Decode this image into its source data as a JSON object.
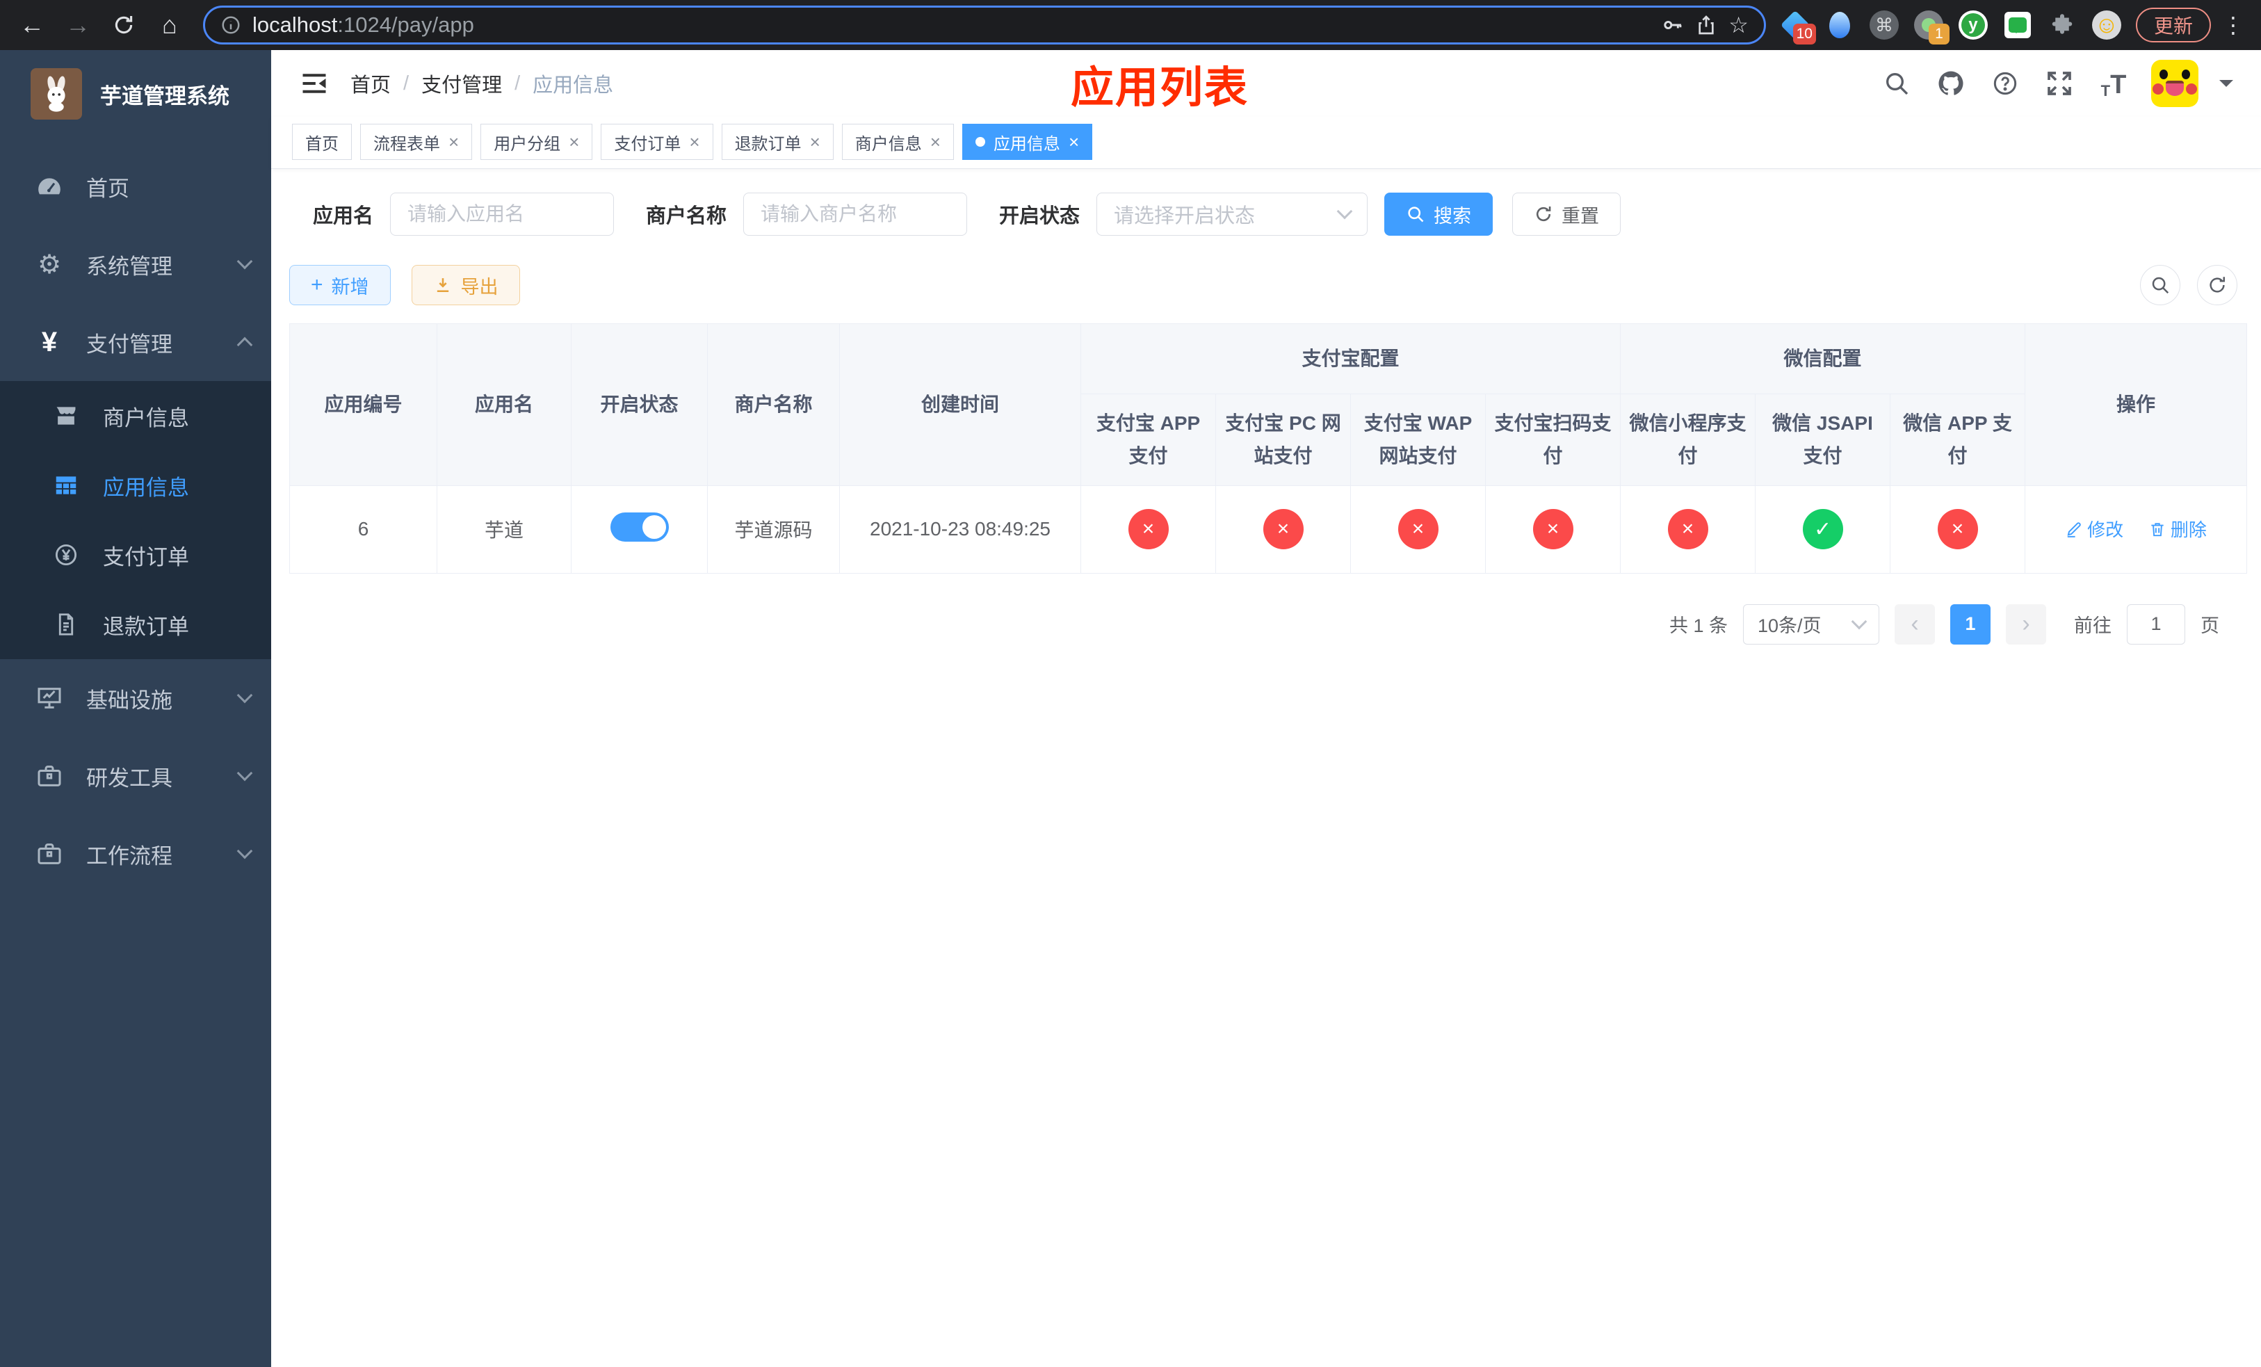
{
  "colors": {
    "accent": "#409eff",
    "success": "#15ce67",
    "danger": "#fb4a4a",
    "warning": "#e6a23c",
    "sidebar_bg": "#304156",
    "submenu_bg": "#1f2d3d",
    "annotation_red": "#ff2d00"
  },
  "browser": {
    "url": {
      "host": "localhost",
      "rest": ":1024/pay/app"
    },
    "update_label": "更新",
    "extensions": {
      "diamond_badge": "10",
      "camera_badge": "1",
      "y_letter": "y"
    }
  },
  "sidebar": {
    "title": "芋道管理系统",
    "menu": [
      {
        "label": "首页"
      },
      {
        "label": "系统管理"
      },
      {
        "label": "支付管理"
      },
      {
        "label": "基础设施"
      },
      {
        "label": "研发工具"
      },
      {
        "label": "工作流程"
      }
    ],
    "submenu_pay": [
      {
        "label": "商户信息"
      },
      {
        "label": "应用信息"
      },
      {
        "label": "支付订单"
      },
      {
        "label": "退款订单"
      }
    ]
  },
  "header": {
    "breadcrumb": [
      "首页",
      "支付管理",
      "应用信息"
    ],
    "annotation": "应用列表"
  },
  "tabs": [
    {
      "label": "首页"
    },
    {
      "label": "流程表单"
    },
    {
      "label": "用户分组"
    },
    {
      "label": "支付订单"
    },
    {
      "label": "退款订单"
    },
    {
      "label": "商户信息"
    },
    {
      "label": "应用信息"
    }
  ],
  "filters": {
    "app_name": {
      "label": "应用名",
      "placeholder": "请输入应用名"
    },
    "merchant": {
      "label": "商户名称",
      "placeholder": "请输入商户名称"
    },
    "status": {
      "label": "开启状态",
      "placeholder": "请选择开启状态"
    },
    "search_label": "搜索",
    "reset_label": "重置"
  },
  "toolbar": {
    "add_label": "新增",
    "export_label": "导出"
  },
  "table": {
    "headers": {
      "app_id": "应用编号",
      "app_name": "应用名",
      "status": "开启状态",
      "merchant": "商户名称",
      "create_time": "创建时间",
      "alipay_group": "支付宝配置",
      "wechat_group": "微信配置",
      "actions": "操作",
      "channels": [
        "支付宝 APP 支付",
        "支付宝 PC 网站支付",
        "支付宝 WAP 网站支付",
        "支付宝扫码支付",
        "微信小程序支付",
        "微信 JSAPI 支付",
        "微信 APP 支付"
      ]
    },
    "rows": [
      {
        "app_id": "6",
        "app_name": "芋道",
        "enabled": "on",
        "merchant": "芋道源码",
        "create_time": "2021-10-23 08:49:25",
        "channels": [
          {
            "state": "off",
            "symbol": "×"
          },
          {
            "state": "off",
            "symbol": "×"
          },
          {
            "state": "off",
            "symbol": "×"
          },
          {
            "state": "off",
            "symbol": "×"
          },
          {
            "state": "off",
            "symbol": "×"
          },
          {
            "state": "on",
            "symbol": "✓"
          },
          {
            "state": "off",
            "symbol": "×"
          }
        ],
        "edit_label": "修改",
        "delete_label": "删除"
      }
    ]
  },
  "pagination": {
    "total": "共 1 条",
    "page_size": "10条/页",
    "prev": "‹",
    "current": "1",
    "next": "›",
    "goto_prefix": "前往",
    "goto_value": "1",
    "goto_suffix": "页"
  }
}
